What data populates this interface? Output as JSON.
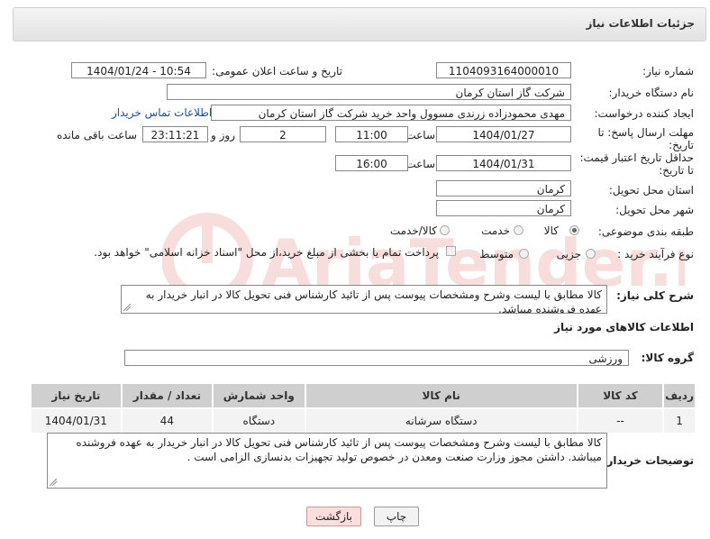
{
  "header": {
    "title": "جزئیات اطلاعات نیاز"
  },
  "fields": {
    "need_number_label": "شماره نیاز:",
    "need_number": "1104093164000010",
    "announce_label": "تاریخ و ساعت اعلان عمومی:",
    "announce_value": "1404/01/24 - 10:54",
    "buyer_org_label": "نام دستگاه خریدار:",
    "buyer_org": "شرکت گاز استان کرمان",
    "creator_label": "ایجاد کننده درخواست:",
    "creator": "مهدی محمودزاده زرندی مسوول واحد خرید شرکت گاز استان کرمان",
    "contact_link": "اطلاعات تماس خریدار",
    "deadline_label_1": "مهلت ارسال پاسخ: تا",
    "deadline_label_2": "تاریخ:",
    "deadline_date": "1404/01/27",
    "time_label": "ساعت",
    "deadline_time": "11:00",
    "days_value": "2",
    "days_label": "روز و",
    "remaining_value": "23:11:21",
    "remaining_label": "ساعت باقی مانده",
    "validity_label_1": "حداقل تاریخ اعتبار قیمت:",
    "validity_label_2": "تا تاریخ:",
    "validity_date": "1404/01/31",
    "validity_time_label": "ساعت",
    "validity_time": "16:00",
    "province_label": "استان محل تحویل:",
    "province": "کرمان",
    "city_label": "شهر محل تحویل:",
    "city": "کرمان",
    "category_label": "طبقه بندی موضوعی:",
    "category_options": [
      "کالا",
      "خدمت",
      "کالا/خدمت"
    ],
    "process_label": "نوع فرآیند خرید :",
    "process_options": [
      "جزیی",
      "متوسط"
    ],
    "payment_note": "پرداخت تمام یا بخشی از مبلغ خرید،از محل \"اسناد خزانه اسلامی\" خواهد بود."
  },
  "description": {
    "label": "شرح کلی نیاز:",
    "text": "کالا مطابق با لیست وشرح ومشخصات پیوست پس از تائید کارشناس فنی تحویل کالا در انبار خریدار به عهده فروشنده میباشد."
  },
  "goods_section": {
    "title": "اطلاعات کالاهای مورد نیاز",
    "group_label": "گروه کالا:",
    "group_value": "ورزشی"
  },
  "table": {
    "headers": [
      "ردیف",
      "کد کالا",
      "نام کالا",
      "واحد شمارش",
      "تعداد / مقدار",
      "تاریخ نیاز"
    ],
    "rows": [
      [
        "1",
        "--",
        "دستگاه سرشانه",
        "دستگاه",
        "44",
        "1404/01/31"
      ]
    ]
  },
  "buyer_notes": {
    "label": "توضیحات خریدار:",
    "text": "کالا مطابق با لیست وشرح ومشخصات پیوست پس از تائید کارشناس فنی تحویل کالا در انبار خریدار به عهده فروشنده میباشد. داشتن مجوز وزارت صنعت ومعدن در خصوص تولید تجهیزات بدنسازی الزامی است ."
  },
  "buttons": {
    "print": "چاپ",
    "back": "بازگشت"
  },
  "watermark_text": "AriaTender.neT"
}
